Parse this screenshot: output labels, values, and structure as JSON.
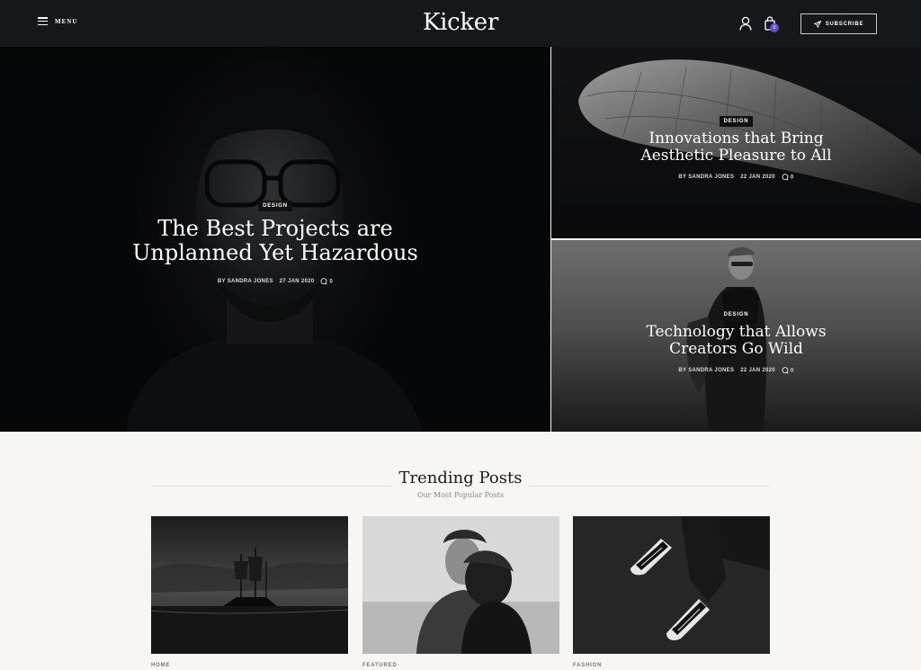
{
  "header": {
    "menu_label": "MENU",
    "logo": "Kicker",
    "cart_count": "0",
    "subscribe_label": "SUBSCRIBE"
  },
  "hero": {
    "main": {
      "category": "DESIGN",
      "title_line1": "The Best Projects are",
      "title_line2": "Unplanned Yet Hazardous",
      "author": "BY SANDRA JONES",
      "date": "27 JAN 2020",
      "comments": "0"
    },
    "side1": {
      "category": "DESIGN",
      "title_line1": "Innovations that Bring",
      "title_line2": "Aesthetic Pleasure to All",
      "author": "BY SANDRA JONES",
      "date": "22 JAN 2020",
      "comments": "0"
    },
    "side2": {
      "category": "DESIGN",
      "title_line1": "Technology that Allows",
      "title_line2": "Creators Go Wild",
      "author": "BY SANDRA JONES",
      "date": "22 JAN 2020",
      "comments": "0"
    }
  },
  "trending": {
    "title": "Trending Posts",
    "subtitle": "Our Most Popular Posts",
    "cards": [
      {
        "category": "HOME",
        "image": "ship-at-night"
      },
      {
        "category": "FEATURED",
        "image": "couple-embrace"
      },
      {
        "category": "FASHION",
        "image": "sneakers-on-asphalt"
      }
    ]
  },
  "icons": {
    "menu": "hamburger-icon",
    "user": "user-icon",
    "cart": "shopping-bag-icon",
    "subscribe": "paper-plane-icon",
    "comment": "comment-icon"
  },
  "colors": {
    "header_bg": "#16171b",
    "accent_badge": "#6a4bd6",
    "page_bg": "#f7f6f3"
  }
}
